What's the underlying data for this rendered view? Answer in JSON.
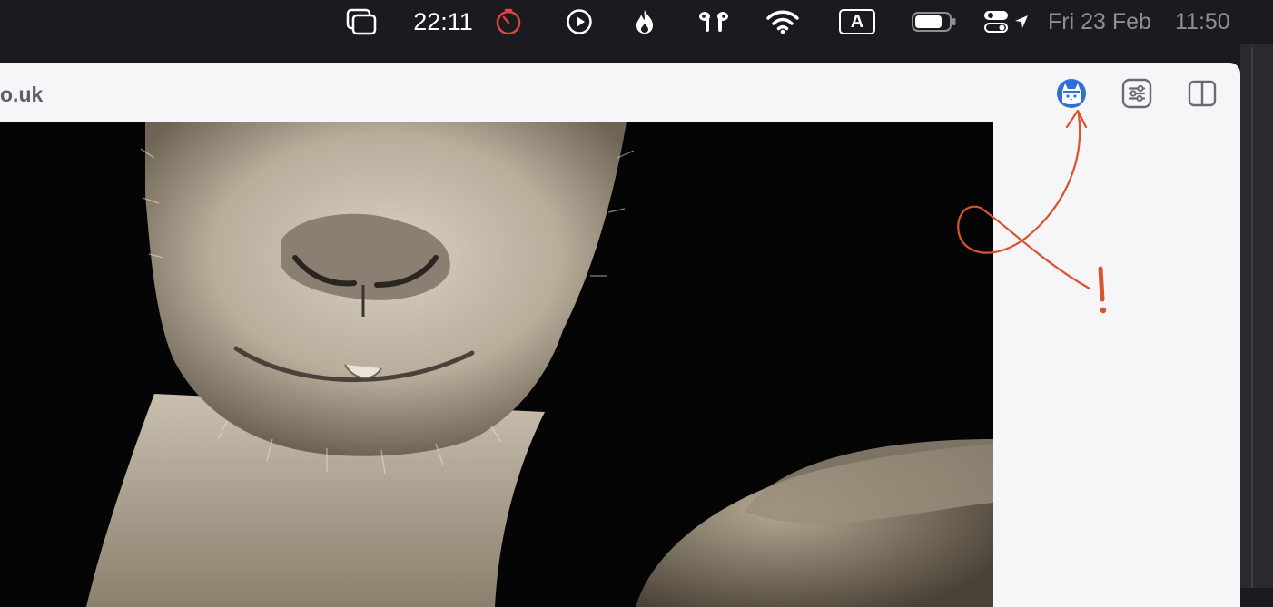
{
  "menubar": {
    "timer_text": "22:11",
    "date_text": "Fri 23 Feb",
    "time_text": "11:50",
    "keyboard_input_label": "A"
  },
  "browser": {
    "url_partial": "o.uk"
  },
  "icons": {
    "menubar": [
      "window-stack-icon",
      "timer-icon",
      "play-icon",
      "flame-icon",
      "airpods-icon",
      "wifi-icon",
      "input-source-icon",
      "battery-icon",
      "control-center-icon",
      "location-arrow-icon"
    ],
    "toolbar": [
      "extension-avatar-icon",
      "page-settings-icon",
      "sidebar-toggle-icon"
    ]
  },
  "colors": {
    "annotation": "#d9532e",
    "avatar_blue": "#2f6fd6",
    "timer_red": "#e0453a"
  }
}
